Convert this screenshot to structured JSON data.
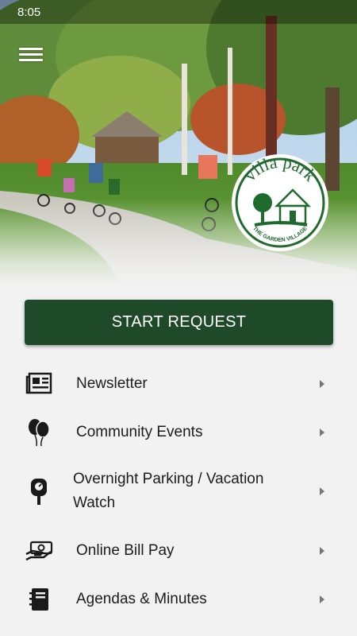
{
  "status_bar": {
    "time": "8:05"
  },
  "header": {
    "menu_icon": "hamburger-menu-icon"
  },
  "logo": {
    "top_text": "villa park",
    "bottom_text": "THE GARDEN VILLAGE",
    "color": "#1f6b2e"
  },
  "primary_action": {
    "label": "START REQUEST",
    "color": "#1f4a2a"
  },
  "menu": {
    "items": [
      {
        "label": "Newsletter",
        "icon": "newspaper-icon"
      },
      {
        "label": "Community Events",
        "icon": "balloons-icon"
      },
      {
        "label": "Overnight Parking / Vacation Watch",
        "icon": "parking-meter-icon"
      },
      {
        "label": "Online Bill Pay",
        "icon": "hand-money-icon"
      },
      {
        "label": "Agendas & Minutes",
        "icon": "notebook-icon"
      }
    ]
  }
}
